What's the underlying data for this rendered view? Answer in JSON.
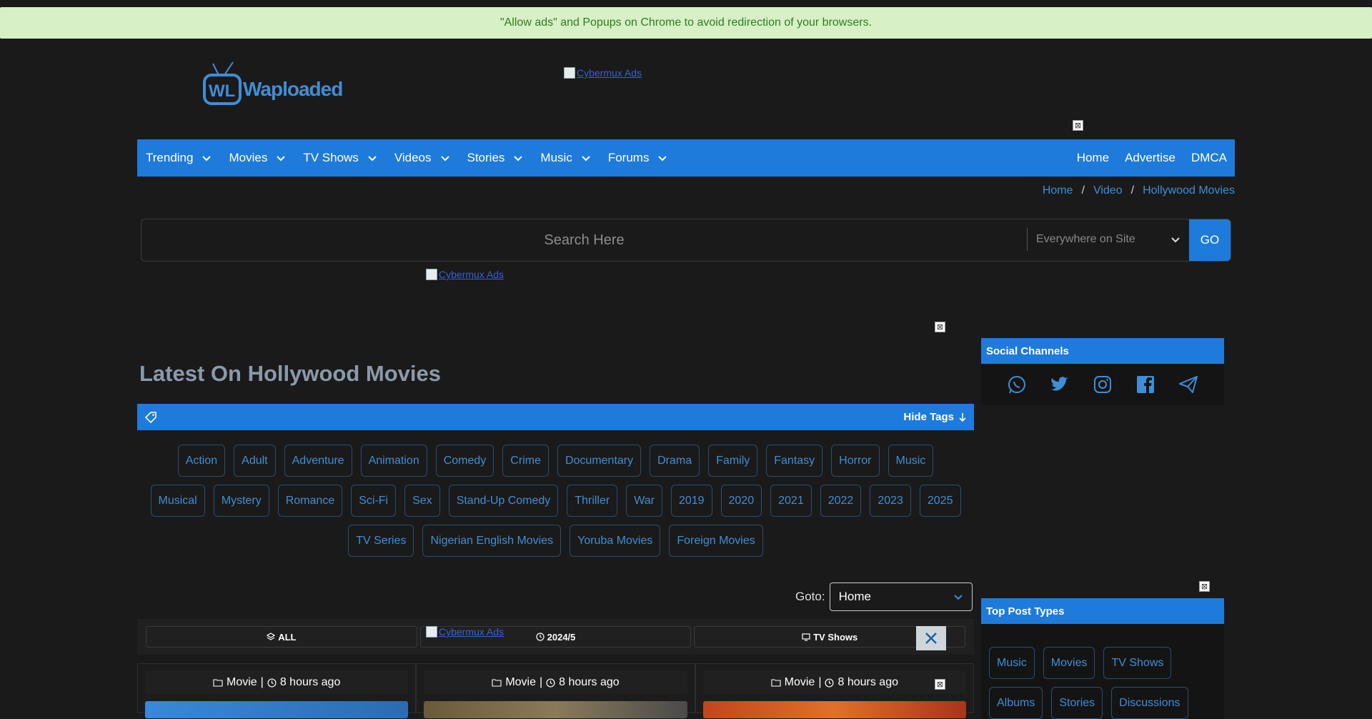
{
  "notice": "\"Allow ads\" and Popups on Chrome to avoid redirection of your browsers.",
  "logo": {
    "text": "Waploaded"
  },
  "ads": {
    "broken_alt": "Cybermux Ads"
  },
  "nav": {
    "left": [
      {
        "label": "Trending"
      },
      {
        "label": "Movies"
      },
      {
        "label": "TV Shows"
      },
      {
        "label": "Videos"
      },
      {
        "label": "Stories"
      },
      {
        "label": "Music"
      },
      {
        "label": "Forums"
      }
    ],
    "right": [
      {
        "label": "Home"
      },
      {
        "label": "Advertise"
      },
      {
        "label": "DMCA"
      }
    ]
  },
  "breadcrumb": {
    "items": [
      "Home",
      "Video",
      "Hollywood Movies"
    ],
    "sep": "/"
  },
  "search": {
    "placeholder": "Search Here",
    "scope": "Everywhere on Site",
    "go": "GO"
  },
  "page_title": "Latest On Hollywood Movies",
  "tagbar": {
    "hide_label": "Hide Tags"
  },
  "tags": [
    "Action",
    "Adult",
    "Adventure",
    "Animation",
    "Comedy",
    "Crime",
    "Documentary",
    "Drama",
    "Family",
    "Fantasy",
    "Horror",
    "Music",
    "Musical",
    "Mystery",
    "Romance",
    "Sci-Fi",
    "Sex",
    "Stand-Up Comedy",
    "Thriller",
    "War",
    "2019",
    "2020",
    "2021",
    "2022",
    "2023",
    "2025",
    "TV Series",
    "Nigerian English Movies",
    "Yoruba Movies",
    "Foreign Movies"
  ],
  "goto": {
    "label": "Goto:",
    "value": "Home"
  },
  "filters": [
    {
      "label": "ALL"
    },
    {
      "label": "2024/5"
    },
    {
      "label": "TV Shows"
    }
  ],
  "cards": [
    {
      "type": "Movie",
      "sep": "|",
      "time": "8 hours ago"
    },
    {
      "type": "Movie",
      "sep": "|",
      "time": "8 hours ago"
    },
    {
      "type": "Movie",
      "sep": "|",
      "time": "8 hours ago"
    }
  ],
  "sidebar": {
    "social_title": "Social Channels",
    "social_icons": [
      "whatsapp-icon",
      "twitter-icon",
      "instagram-icon",
      "facebook-icon",
      "telegram-icon"
    ],
    "types_title": "Top Post Types",
    "types": [
      "Music",
      "Movies",
      "TV Shows",
      "Albums",
      "Stories",
      "Discussions"
    ]
  },
  "colors": {
    "accent": "#1e7bdb",
    "link": "#3f8ed6",
    "bg": "#1a1a1a",
    "notice_bg": "#d7f0c6",
    "notice_text": "#2f7d1f"
  }
}
